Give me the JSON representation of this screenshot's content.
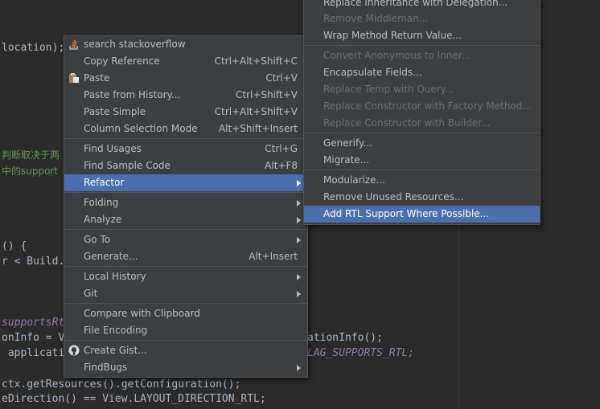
{
  "editor": {
    "lines": [
      "location);",
      "",
      "判断取决于两",
      "中的support",
      "() {",
      "r < Build.V",
      "supportsRt",
      "onInfo = V",
      " application",
      "ationInfo();",
      "LAG_SUPPORTS_RTL;",
      "ctx.getResources().getConfiguration();",
      "eDirection() == View.LAYOUT_DIRECTION_RTL;"
    ]
  },
  "context_menu": {
    "items": [
      {
        "label": "search stackoverflow",
        "shortcut": "",
        "icon": "stackoverflow-icon"
      },
      {
        "label": "Copy Reference",
        "shortcut": "Ctrl+Alt+Shift+C"
      },
      {
        "label": "Paste",
        "shortcut": "Ctrl+V",
        "icon": "paste-icon"
      },
      {
        "label": "Paste from History...",
        "shortcut": "Ctrl+Shift+V"
      },
      {
        "label": "Paste Simple",
        "shortcut": "Ctrl+Alt+Shift+V"
      },
      {
        "label": "Column Selection Mode",
        "shortcut": "Alt+Shift+Insert"
      },
      {
        "label": "Find Usages",
        "shortcut": "Ctrl+G"
      },
      {
        "label": "Find Sample Code",
        "shortcut": "Alt+F8"
      },
      {
        "label": "Refactor",
        "shortcut": ""
      },
      {
        "label": "Folding",
        "shortcut": ""
      },
      {
        "label": "Analyze",
        "shortcut": ""
      },
      {
        "label": "Go To",
        "shortcut": ""
      },
      {
        "label": "Generate...",
        "shortcut": "Alt+Insert"
      },
      {
        "label": "Local History",
        "shortcut": ""
      },
      {
        "label": "Git",
        "shortcut": ""
      },
      {
        "label": "Compare with Clipboard",
        "shortcut": ""
      },
      {
        "label": "File Encoding",
        "shortcut": ""
      },
      {
        "label": "Create Gist...",
        "shortcut": "",
        "icon": "github-icon"
      },
      {
        "label": "FindBugs",
        "shortcut": ""
      }
    ]
  },
  "refactor_submenu": {
    "items": [
      {
        "label": "Replace Inheritance with Delegation..."
      },
      {
        "label": "Remove Middleman..."
      },
      {
        "label": "Wrap Method Return Value..."
      },
      {
        "label": "Convert Anonymous to Inner..."
      },
      {
        "label": "Encapsulate Fields..."
      },
      {
        "label": "Replace Temp with Query..."
      },
      {
        "label": "Replace Constructor with Factory Method..."
      },
      {
        "label": "Replace Constructor with Builder..."
      },
      {
        "label": "Generify..."
      },
      {
        "label": "Migrate..."
      },
      {
        "label": "Modularize..."
      },
      {
        "label": "Remove Unused Resources..."
      },
      {
        "label": "Add RTL Support Where Possible..."
      }
    ]
  },
  "colors": {
    "menu_bg": "#3c3f41",
    "selection": "#4b6eaf",
    "editor_bg": "#2b2b2b",
    "disabled_text": "#6e6e6e"
  }
}
